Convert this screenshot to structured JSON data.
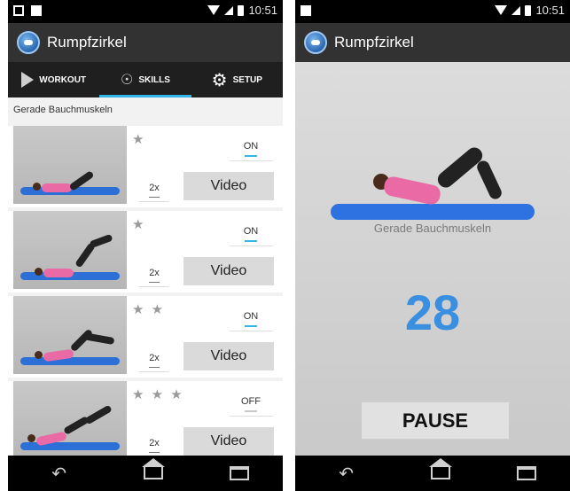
{
  "left_screen": {
    "status": {
      "time": "10:51"
    },
    "app_title": "Rumpfzirkel",
    "tabs": [
      {
        "label": "WORKOUT",
        "icon": "play-icon",
        "active": false
      },
      {
        "label": "SKILLS",
        "icon": "person-icon",
        "active": true
      },
      {
        "label": "SETUP",
        "icon": "gear-icon",
        "active": false
      }
    ],
    "section_title": "Gerade Bauchmuskeln",
    "exercises": [
      {
        "stars": "★",
        "toggle": "ON",
        "count": "2x",
        "video_label": "Video"
      },
      {
        "stars": "★",
        "toggle": "ON",
        "count": "2x",
        "video_label": "Video"
      },
      {
        "stars": "★ ★",
        "toggle": "ON",
        "count": "2x",
        "video_label": "Video"
      },
      {
        "stars": "★ ★ ★",
        "toggle": "OFF",
        "count": "2x",
        "video_label": "Video"
      }
    ]
  },
  "right_screen": {
    "status": {
      "time": "10:51"
    },
    "app_title": "Rumpfzirkel",
    "exercise_name": "Gerade Bauchmuskeln",
    "counter": "28",
    "pause_label": "PAUSE"
  },
  "colors": {
    "accent": "#33b5e5",
    "counter": "#3a8fe0",
    "mat": "#2c6fd6",
    "actionbar": "#323232"
  }
}
